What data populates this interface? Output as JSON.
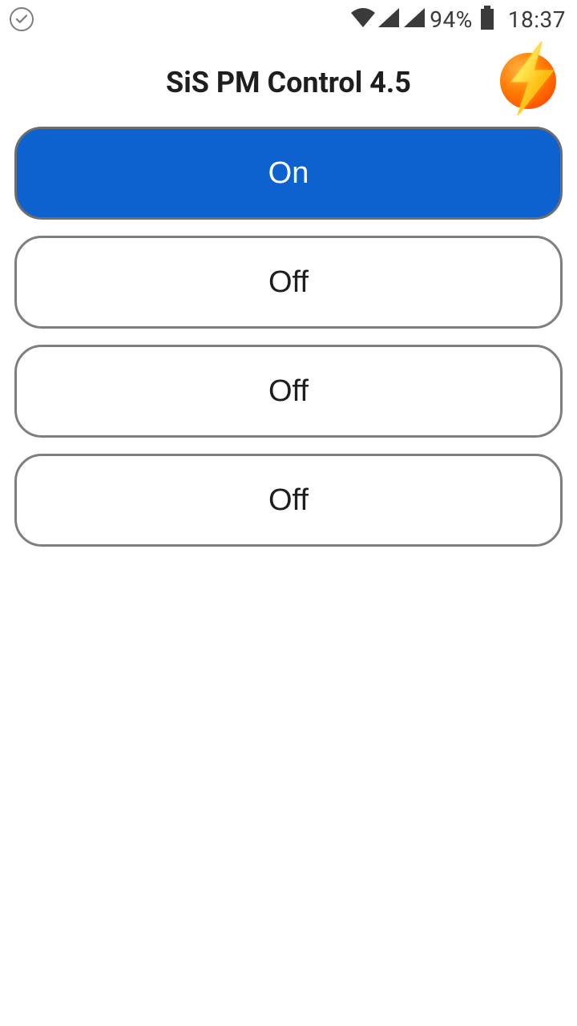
{
  "statusbar": {
    "battery_pct": "94%",
    "time": "18:37"
  },
  "header": {
    "title": "SiS PM Control 4.5"
  },
  "outlets": [
    {
      "label": "On",
      "state": "on"
    },
    {
      "label": "Off",
      "state": "off"
    },
    {
      "label": "Off",
      "state": "off"
    },
    {
      "label": "Off",
      "state": "off"
    }
  ]
}
